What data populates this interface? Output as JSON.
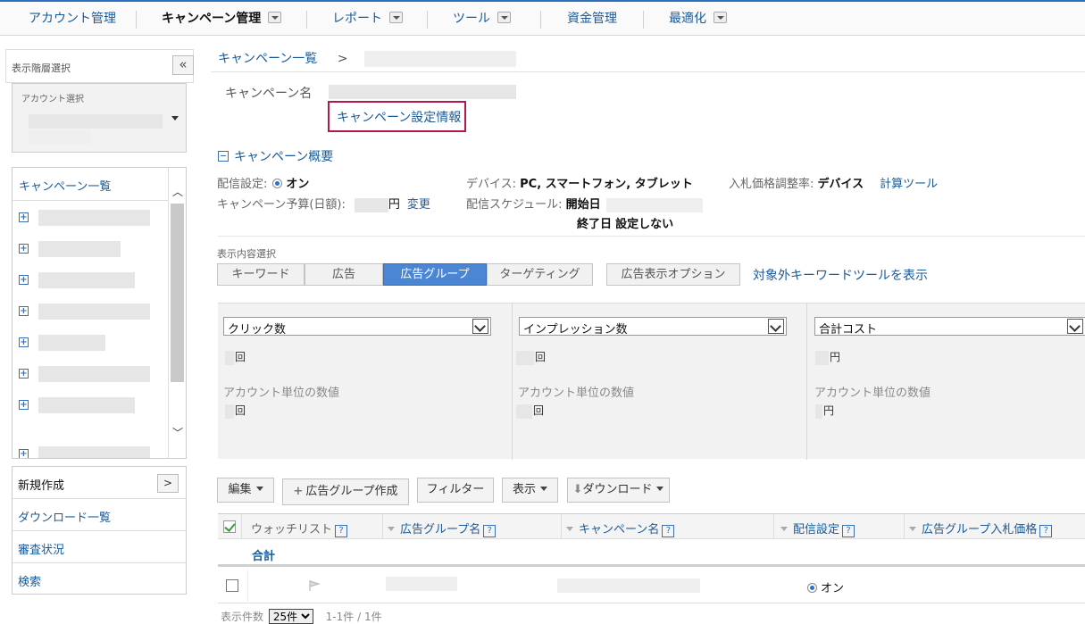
{
  "nav": {
    "items": [
      {
        "label": "アカウント管理",
        "has_dropdown": false,
        "active": false
      },
      {
        "label": "キャンペーン管理",
        "has_dropdown": true,
        "active": true
      },
      {
        "label": "レポート",
        "has_dropdown": true,
        "active": false
      },
      {
        "label": "ツール",
        "has_dropdown": true,
        "active": false
      },
      {
        "label": "資金管理",
        "has_dropdown": false,
        "active": false
      },
      {
        "label": "最適化",
        "has_dropdown": true,
        "active": false
      }
    ],
    "accent_color": "#2d6fbf"
  },
  "left_panel": {
    "header": "表示階層選択",
    "collapse_label": "«",
    "account_select_label": "アカウント選択",
    "campaign_list_title": "キャンペーン一覧",
    "menu": [
      {
        "label": "新規作成"
      },
      {
        "label": "ダウンロード一覧"
      },
      {
        "label": "審査状況"
      },
      {
        "label": "検索"
      }
    ]
  },
  "breadcrumb": {
    "root": "キャンペーン一覧",
    "separator": ">"
  },
  "campaign": {
    "name_label": "キャンペーン名",
    "settings_link": "キャンペーン設定情報",
    "overview_label": "キャンペーン概要",
    "delivery_label": "配信設定:",
    "delivery_value": "オン",
    "device_label": "デバイス:",
    "device_value": "PC, スマートフォン, タブレット",
    "bid_adj_label": "入札価格調整率:",
    "bid_adj_value": "デバイス",
    "calc_tool": "計算ツール",
    "budget_label": "キャンペーン予算(日額):",
    "budget_unit": "円",
    "change_link": "変更",
    "schedule_label": "配信スケジュール:",
    "start_label": "開始日",
    "end_label": "終了日",
    "end_value": "設定しない"
  },
  "display": {
    "label": "表示内容選択",
    "tabs": [
      {
        "label": "キーワード",
        "active": false
      },
      {
        "label": "広告",
        "active": false
      },
      {
        "label": "広告グループ",
        "active": true
      },
      {
        "label": "ターゲティング",
        "active": false
      }
    ],
    "ad_ext_tab": "広告表示オプション",
    "negative_tool_link": "対象外キーワードツールを表示"
  },
  "metrics": [
    {
      "select": "クリック数",
      "unit": "回",
      "account_label": "アカウント単位の数値",
      "account_unit": "回"
    },
    {
      "select": "インプレッション数",
      "unit": "回",
      "account_label": "アカウント単位の数値",
      "account_unit": "回"
    },
    {
      "select": "合計コスト",
      "unit": "円",
      "account_label": "アカウント単位の数値",
      "account_unit": "円"
    }
  ],
  "toolbar": {
    "edit": "編集",
    "create_group": "広告グループ作成",
    "filter": "フィルター",
    "display": "表示",
    "download": "ダウンロード"
  },
  "grid": {
    "headers": {
      "watchlist": "ウォッチリスト",
      "ad_group_name": "広告グループ名",
      "campaign_name": "キャンペーン名",
      "delivery": "配信設定",
      "bid": "広告グループ入札価格"
    },
    "help_mark": "?",
    "total_label": "合計",
    "row_status": "オン"
  },
  "pager": {
    "label": "表示件数",
    "per_page": "25件",
    "range": "1-1件 / 1件"
  }
}
